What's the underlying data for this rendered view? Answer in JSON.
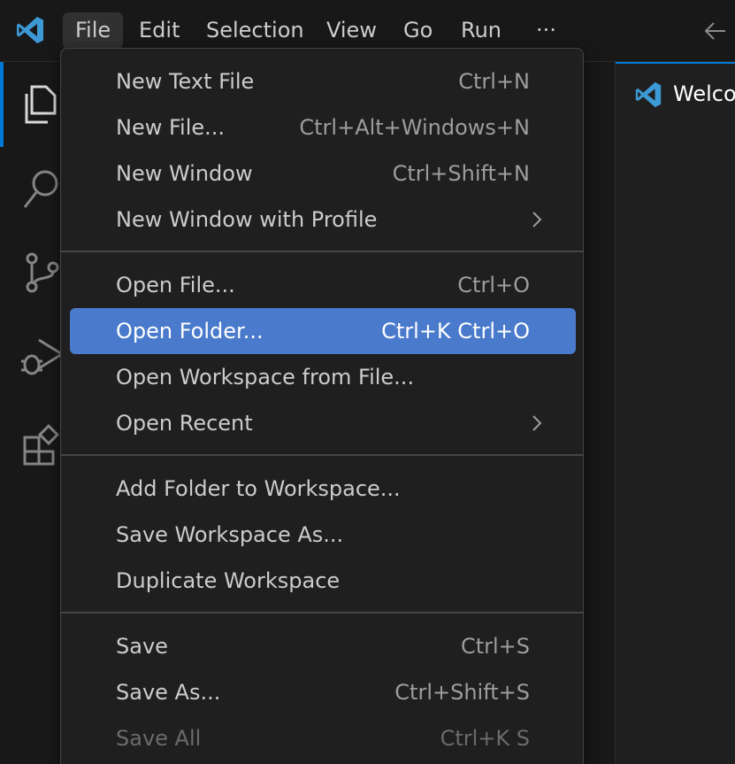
{
  "menubar": {
    "items": [
      "File",
      "Edit",
      "Selection",
      "View",
      "Go",
      "Run",
      "···"
    ]
  },
  "editor": {
    "tab_label": "Welco"
  },
  "file_menu": {
    "highlight_color": "#4a7acb",
    "groups": [
      [
        {
          "label": "New Text File",
          "shortcut": "Ctrl+N"
        },
        {
          "label": "New File...",
          "shortcut": "Ctrl+Alt+Windows+N"
        },
        {
          "label": "New Window",
          "shortcut": "Ctrl+Shift+N"
        },
        {
          "label": "New Window with Profile",
          "submenu": true
        }
      ],
      [
        {
          "label": "Open File...",
          "shortcut": "Ctrl+O"
        },
        {
          "label": "Open Folder...",
          "shortcut": "Ctrl+K Ctrl+O",
          "highlighted": true
        },
        {
          "label": "Open Workspace from File..."
        },
        {
          "label": "Open Recent",
          "submenu": true
        }
      ],
      [
        {
          "label": "Add Folder to Workspace..."
        },
        {
          "label": "Save Workspace As..."
        },
        {
          "label": "Duplicate Workspace"
        }
      ],
      [
        {
          "label": "Save",
          "shortcut": "Ctrl+S"
        },
        {
          "label": "Save As...",
          "shortcut": "Ctrl+Shift+S"
        },
        {
          "label": "Save All",
          "shortcut": "Ctrl+K S",
          "disabled": true
        }
      ]
    ]
  },
  "icons": {
    "app_logo": "vscode-logo-icon",
    "back": "arrow-left-icon",
    "explorer": "files-icon",
    "search": "search-icon",
    "source_control": "source-control-icon",
    "run_debug": "run-debug-icon",
    "extensions": "extensions-icon",
    "submenu": "chevron-right-icon"
  }
}
